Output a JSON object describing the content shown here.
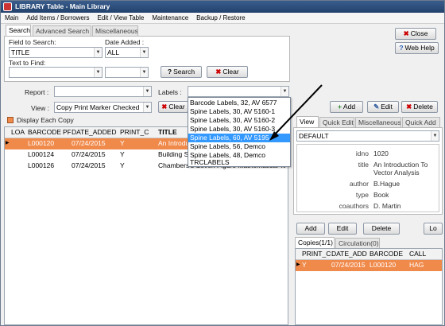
{
  "window": {
    "title": "LIBRARY Table - Main Library"
  },
  "menu": [
    "Main",
    "Add Items / Borrowers",
    "Edit / View Table",
    "Maintenance",
    "Backup / Restore"
  ],
  "search_tabs": [
    "Search",
    "Advanced Search",
    "Miscellaneous"
  ],
  "search": {
    "field_label": "Field to Search:",
    "field_value": "TITLE",
    "date_label": "Date Added :",
    "date_value": "ALL",
    "find_label": "Text to Find:",
    "search_btn": "Search",
    "clear_btn": "Clear"
  },
  "buttons": {
    "close": "Close",
    "help": "Web Help"
  },
  "report": {
    "label": "Report :",
    "value": ""
  },
  "labels": {
    "label": "Labels :",
    "value": "",
    "options": [
      "Barcode Labels, 32, AV 6577",
      "Spine Labels, 30, AV 5160-1",
      "Spine Labels, 30, AV 5160-2",
      "Spine Labels, 30, AV 5160-3",
      "Spine Labels, 60, AV 5195",
      "Spine Labels, 56, Demco",
      "Spine Labels, 48, Demco",
      "TRCLABELS"
    ],
    "selected_index": 4
  },
  "view": {
    "label": "View :",
    "value": "Copy Print Marker Checked",
    "clear_btn": "Clear"
  },
  "actions": {
    "add": "Add",
    "edit": "Edit",
    "delete": "Delete"
  },
  "display_each_copy": "Display Each Copy",
  "table": {
    "columns": [
      "LOA",
      "BARCODE",
      "PF",
      "DATE_ADDED",
      "PRINT_C",
      "TITLE"
    ],
    "rows": [
      {
        "barcode": "L000120",
        "date": "07/24/2015",
        "print": "Y",
        "title": "An Introduction To Vector Analysis",
        "selected": true
      },
      {
        "barcode": "L000124",
        "date": "07/24/2015",
        "print": "Y",
        "title": "Building Stronger Families",
        "selected": false
      },
      {
        "barcode": "L000126",
        "date": "07/24/2015",
        "print": "Y",
        "title": "Chambers's Seven Figure Mathematical Tables",
        "selected": false
      }
    ]
  },
  "right_tabs": [
    "View",
    "Quick Edit",
    "Miscellaneous",
    "Quick Add"
  ],
  "right_view": {
    "preset": "DEFAULT",
    "props": [
      {
        "label": "idno",
        "value": "1020"
      },
      {
        "label": "title",
        "value": "An Introduction To Vector Analysis"
      },
      {
        "label": "author",
        "value": "B.Hague"
      },
      {
        "label": "type",
        "value": "Book"
      },
      {
        "label": "coauthors",
        "value": "D. Martin"
      }
    ]
  },
  "copies_buttons": {
    "add": "Add",
    "edit": "Edit",
    "delete": "Delete",
    "lo": "Lo"
  },
  "copy_tabs": [
    "Copies(1/1)",
    "Circulation(0)"
  ],
  "copies": {
    "columns": [
      "PRINT_C",
      "DATE_ADDI",
      "BARCODE",
      "CALL"
    ],
    "rows": [
      {
        "print": "Y",
        "date": "07/24/2015",
        "barcode": "L000120",
        "call": "HAG"
      }
    ]
  },
  "colors": {
    "selection": "#f08a4b",
    "highlight": "#3399ff",
    "title_bar": "#2d4f7c"
  }
}
